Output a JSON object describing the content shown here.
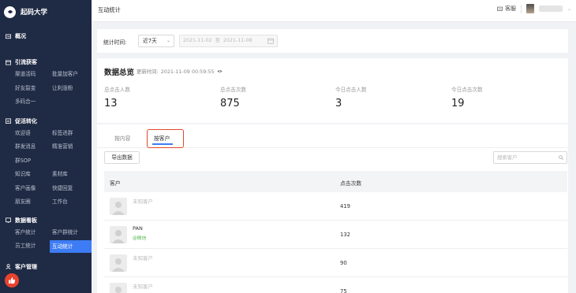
{
  "sidebar": {
    "brand": "起码大学",
    "sections": [
      {
        "title": "概况",
        "icon": "dashboard-icon",
        "items": []
      },
      {
        "title": "引流获客",
        "icon": "funnel-icon",
        "items": [
          "渠道活码",
          "批量加客户",
          "好友裂变",
          "让利涨粉",
          "多码合一"
        ]
      },
      {
        "title": "促活转化",
        "icon": "calendar-icon",
        "items": [
          "欢迎语",
          "标签进群",
          "群发消息",
          "精准营销",
          "群SOP",
          "",
          "知识库",
          "素材库",
          "客户画像",
          "快捷回复",
          "朋友圈",
          "工作台"
        ]
      },
      {
        "title": "数据看板",
        "icon": "chart-icon",
        "items": [
          "客户统计",
          "客户群统计",
          "员工统计",
          "互动统计"
        ]
      },
      {
        "title": "客户管理",
        "icon": "user-icon",
        "items": []
      }
    ],
    "active_item": "互动统计"
  },
  "header": {
    "title": "互动统计",
    "service_label": "客服"
  },
  "filter": {
    "label": "统计时间:",
    "range": "近7天",
    "date_start": "2021-11-02",
    "date_sep": "至",
    "date_end": "2021-11-08"
  },
  "overview": {
    "title": "数据总览",
    "update_label": "更新时间:",
    "update_time": "2021-11-09 00:59:55",
    "stats": [
      {
        "label": "总点击人数",
        "value": "13"
      },
      {
        "label": "总点击次数",
        "value": "875"
      },
      {
        "label": "今日点击人数",
        "value": "3"
      },
      {
        "label": "今日点击次数",
        "value": "19"
      }
    ]
  },
  "table": {
    "tabs": [
      "按内容",
      "按客户"
    ],
    "active_tab": "按客户",
    "export_label": "导出数据",
    "search_placeholder": "搜索客户",
    "columns": [
      "客户",
      "点击次数"
    ],
    "rows": [
      {
        "name": "未知客户",
        "sub": "",
        "clicks": "419"
      },
      {
        "name": "PAN",
        "sub": "@微信",
        "clicks": "132"
      },
      {
        "name": "未知客户",
        "sub": "",
        "clicks": "90"
      },
      {
        "name": "未知客户",
        "sub": "",
        "clicks": "75"
      }
    ]
  },
  "colors": {
    "sidebar_bg": "#1f2a44",
    "accent": "#3d7cf4",
    "highlight": "#e0492c",
    "wechat_green": "#52b84c"
  }
}
